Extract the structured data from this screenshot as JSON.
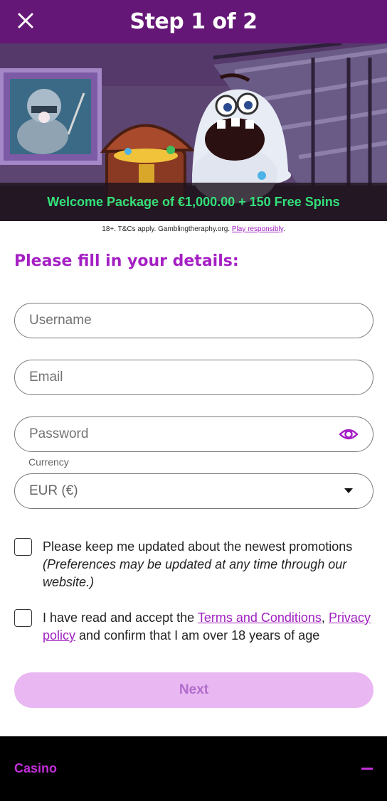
{
  "header": {
    "title": "Step 1 of 2",
    "close_icon": "close-icon"
  },
  "banner": {
    "promo": "Welcome Package of €1,000.00 + 150 Free Spins",
    "disclaimer_prefix": "18+. T&Cs apply. Gamblingtheraphy.org.",
    "disclaimer_link": "Play responsibly",
    "disclaimer_suffix": "."
  },
  "form": {
    "title": "Please fill in your details:",
    "username_placeholder": "Username",
    "email_placeholder": "Email",
    "password_placeholder": "Password",
    "password_toggle_icon": "eye-icon",
    "currency_label": "Currency",
    "currency_value": "EUR (€)",
    "currency_arrow_icon": "caret-down-icon"
  },
  "consents": {
    "promotions_text": "Please keep me updated about the newest promotions",
    "promotions_note": "(Preferences may be updated at any time through our website.)",
    "terms_prefix": "I have read and accept the ",
    "terms_link": "Terms and Conditions",
    "terms_comma": ", ",
    "privacy_link": "Privacy policy",
    "terms_suffix": " and confirm that I am over 18 years of age"
  },
  "actions": {
    "next_label": "Next"
  },
  "footer": {
    "section_label": "Casino",
    "toggle_icon": "minus-icon"
  },
  "colors": {
    "header_bg": "#651777",
    "accent": "#a51fc4",
    "promo_green": "#33e07a",
    "next_disabled_bg": "#e9b7f2",
    "footer_bg": "#000000"
  }
}
